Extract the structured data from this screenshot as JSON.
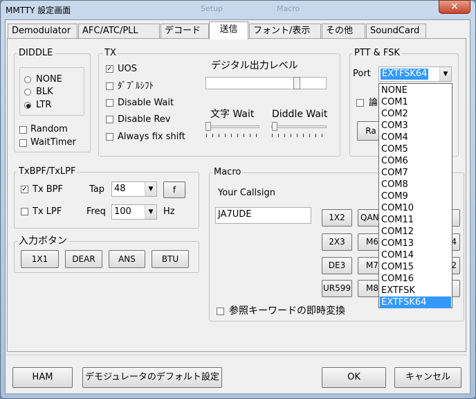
{
  "window": {
    "title": "MMTTY 設定画面",
    "ghost_left": "Setup",
    "ghost_right": "Macro",
    "close_glyph": "✕"
  },
  "tabs": [
    "Demodulator",
    "AFC/ATC/PLL",
    "デコード",
    "送信",
    "フォント/表示",
    "その他",
    "SoundCard"
  ],
  "diddle": {
    "title": "DIDDLE",
    "options": [
      "NONE",
      "BLK",
      "LTR"
    ],
    "selected": "LTR",
    "random": "Random",
    "waittimer": "WaitTimer"
  },
  "tx": {
    "title": "TX",
    "uos": "UOS",
    "uos_checked": true,
    "dual_shift": "ﾀﾞﾌﾞﾙｼﾌﾄ",
    "disable_wait": "Disable Wait",
    "disable_rev": "Disable Rev",
    "always_fix_shift": "Always fix shift",
    "output_level_label": "デジタル出力レベル",
    "char_wait_label": "文字 Wait",
    "diddle_wait_label": "Diddle Wait"
  },
  "ptt": {
    "title": "PTT & FSK",
    "port_label": "Port",
    "port_value": "EXTFSK64",
    "hidden_check_label": "論",
    "hidden_button_label": "Ra",
    "dropdown_options": [
      "NONE",
      "COM1",
      "COM2",
      "COM3",
      "COM4",
      "COM5",
      "COM6",
      "COM7",
      "COM8",
      "COM9",
      "COM10",
      "COM11",
      "COM12",
      "COM13",
      "COM14",
      "COM15",
      "COM16",
      "EXTFSK",
      "EXTFSK64"
    ],
    "dropdown_selected": "EXTFSK64"
  },
  "txbpf": {
    "title": "TxBPF/TxLPF",
    "txbpf": "Tx BPF",
    "txbpf_checked": true,
    "tap_label": "Tap",
    "tap_value": "48",
    "f_button": "f",
    "txlpf": "Tx LPF",
    "freq_label": "Freq",
    "freq_value": "100",
    "hz_label": "Hz"
  },
  "input_buttons": {
    "title": "入力ボタン",
    "buttons": [
      "1X1",
      "DEAR",
      "ANS",
      "BTU"
    ]
  },
  "macro": {
    "title": "Macro",
    "callsign_label": "Your Callsign",
    "callsign_value": "JA7UDE",
    "buttons": [
      "1X2",
      "QAN",
      "2X3",
      "M6",
      "DE3",
      "M7",
      "UR599",
      "M8"
    ],
    "edge_glyphs": [
      "4",
      "2"
    ],
    "instant_convert": "参照キーワードの即時変換"
  },
  "footer": {
    "ham": "HAM",
    "default_demod": "デモジュレータのデフォルト設定",
    "ok": "OK",
    "cancel": "キャンセル"
  }
}
